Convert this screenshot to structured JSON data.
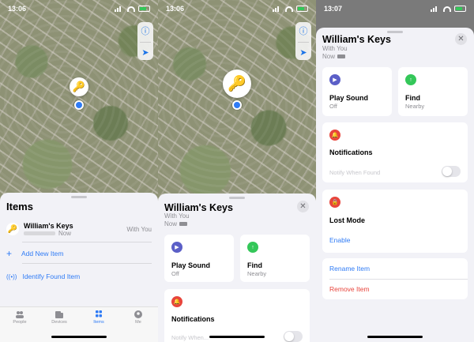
{
  "status": {
    "time1": "13:06",
    "time2": "13:06",
    "time3": "13:07"
  },
  "items_sheet": {
    "title": "Items",
    "item": {
      "name": "William's Keys",
      "location": "Now",
      "status": "With You"
    },
    "add_new": "Add New Item",
    "identify": "Identify Found Item"
  },
  "tabs": [
    {
      "label": "People",
      "icon": "people-icon"
    },
    {
      "label": "Devices",
      "icon": "devices-icon"
    },
    {
      "label": "Items",
      "icon": "items-icon"
    },
    {
      "label": "Me",
      "icon": "me-icon"
    }
  ],
  "detail": {
    "title": "William's Keys",
    "subtitle": "With You",
    "now": "Now",
    "play_sound": {
      "label": "Play Sound",
      "sub": "Off"
    },
    "find": {
      "label": "Find",
      "sub": "Nearby"
    },
    "notifications": {
      "label": "Notifications",
      "notify_when_found": "Notify When Found",
      "notify_partial": "Notify When..."
    },
    "lost_mode": {
      "label": "Lost Mode",
      "action": "Enable"
    },
    "rename": "Rename Item",
    "remove": "Remove Item"
  },
  "colors": {
    "accent": "#2f7bf5",
    "play": "#5b5fc7",
    "find": "#34c759",
    "notify": "#e8453c",
    "lost": "#e8453c"
  }
}
